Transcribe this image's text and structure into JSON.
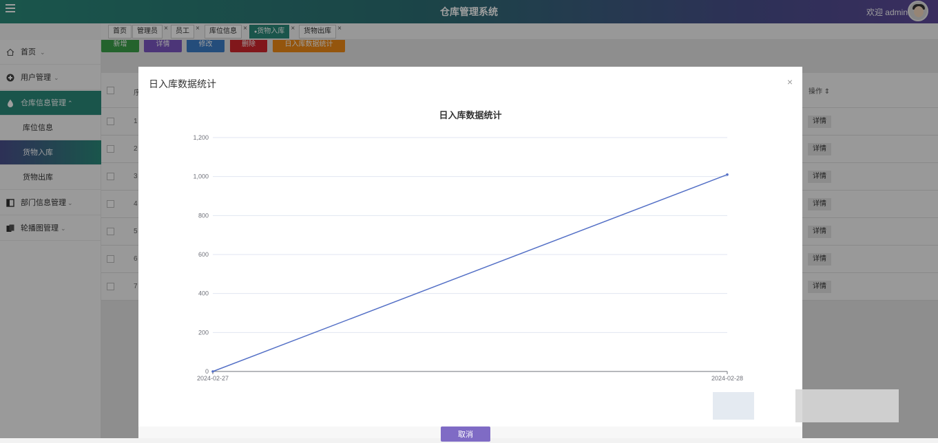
{
  "header": {
    "title": "仓库管理系统",
    "welcome": "欢迎 admin"
  },
  "tabs": [
    {
      "label": "首页",
      "closable": false,
      "active": false
    },
    {
      "label": "管理员",
      "closable": true,
      "active": false
    },
    {
      "label": "员工",
      "closable": true,
      "active": false
    },
    {
      "label": "库位信息",
      "closable": true,
      "active": false
    },
    {
      "label": "货物入库",
      "closable": true,
      "active": true
    },
    {
      "label": "货物出库",
      "closable": true,
      "active": false
    }
  ],
  "tab_close_glyph": "×",
  "tab_active_dot": "●",
  "sidebar": {
    "items": [
      {
        "label": "首页",
        "icon": "home-icon"
      },
      {
        "label": "用户管理",
        "icon": "user-icon"
      },
      {
        "label": "仓库信息管理",
        "icon": "warehouse-icon"
      },
      {
        "label": "库位信息",
        "icon": ""
      },
      {
        "label": "货物入库",
        "icon": ""
      },
      {
        "label": "货物出库",
        "icon": ""
      },
      {
        "label": "部门信息管理",
        "icon": "department-icon"
      },
      {
        "label": "轮播图管理",
        "icon": "carousel-icon"
      }
    ]
  },
  "toolbar": {
    "add": "新增",
    "detail": "详情",
    "edit": "修改",
    "delete": "删除",
    "stats": "日入库数据统计",
    "colors": {
      "add": "#3aa14a",
      "detail": "#7b56c2",
      "edit": "#3b7cc7",
      "delete": "#d0262d",
      "stats": "#ef8a16"
    }
  },
  "table": {
    "rows": [
      "1",
      "2",
      "3",
      "4",
      "5",
      "6",
      "7"
    ],
    "header_prefix": "序",
    "op_header": "操作",
    "op_sort": "⇕",
    "op_label": "详情"
  },
  "modal": {
    "title": "日入库数据统计",
    "close": "×",
    "cancel": "取消"
  },
  "chart_data": {
    "type": "line",
    "title": "日入库数据统计",
    "x": [
      "2024-02-27",
      "2024-02-28"
    ],
    "series": [
      {
        "values": [
          0,
          1010
        ]
      }
    ],
    "ylim": [
      0,
      1200
    ],
    "yticks": [
      0,
      200,
      400,
      600,
      800,
      1000,
      1200
    ],
    "ytick_labels": [
      "0",
      "200",
      "400",
      "600",
      "800",
      "1,000",
      "1,200"
    ],
    "grid": true,
    "line_color": "#5470c6"
  }
}
